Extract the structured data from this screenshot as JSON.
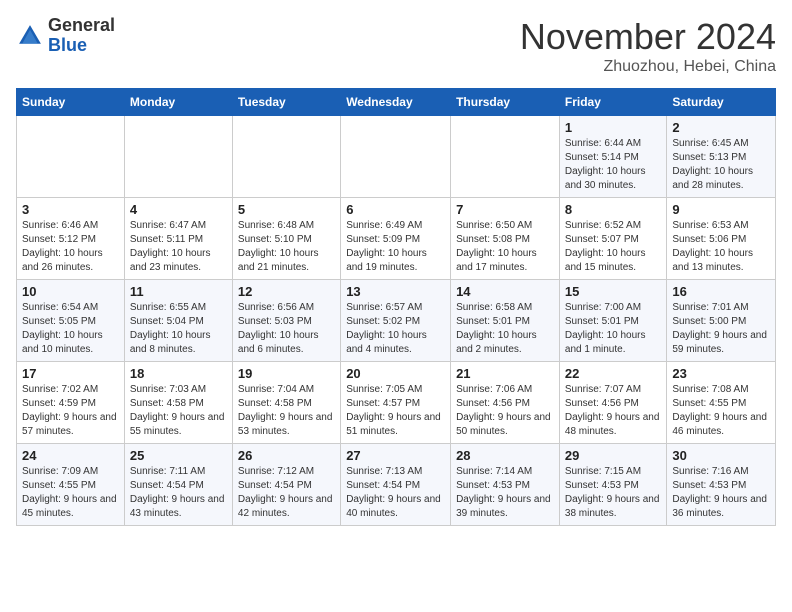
{
  "header": {
    "logo_general": "General",
    "logo_blue": "Blue",
    "month": "November 2024",
    "location": "Zhuozhou, Hebei, China"
  },
  "weekdays": [
    "Sunday",
    "Monday",
    "Tuesday",
    "Wednesday",
    "Thursday",
    "Friday",
    "Saturday"
  ],
  "weeks": [
    [
      {
        "day": "",
        "info": ""
      },
      {
        "day": "",
        "info": ""
      },
      {
        "day": "",
        "info": ""
      },
      {
        "day": "",
        "info": ""
      },
      {
        "day": "",
        "info": ""
      },
      {
        "day": "1",
        "info": "Sunrise: 6:44 AM\nSunset: 5:14 PM\nDaylight: 10 hours and 30 minutes."
      },
      {
        "day": "2",
        "info": "Sunrise: 6:45 AM\nSunset: 5:13 PM\nDaylight: 10 hours and 28 minutes."
      }
    ],
    [
      {
        "day": "3",
        "info": "Sunrise: 6:46 AM\nSunset: 5:12 PM\nDaylight: 10 hours and 26 minutes."
      },
      {
        "day": "4",
        "info": "Sunrise: 6:47 AM\nSunset: 5:11 PM\nDaylight: 10 hours and 23 minutes."
      },
      {
        "day": "5",
        "info": "Sunrise: 6:48 AM\nSunset: 5:10 PM\nDaylight: 10 hours and 21 minutes."
      },
      {
        "day": "6",
        "info": "Sunrise: 6:49 AM\nSunset: 5:09 PM\nDaylight: 10 hours and 19 minutes."
      },
      {
        "day": "7",
        "info": "Sunrise: 6:50 AM\nSunset: 5:08 PM\nDaylight: 10 hours and 17 minutes."
      },
      {
        "day": "8",
        "info": "Sunrise: 6:52 AM\nSunset: 5:07 PM\nDaylight: 10 hours and 15 minutes."
      },
      {
        "day": "9",
        "info": "Sunrise: 6:53 AM\nSunset: 5:06 PM\nDaylight: 10 hours and 13 minutes."
      }
    ],
    [
      {
        "day": "10",
        "info": "Sunrise: 6:54 AM\nSunset: 5:05 PM\nDaylight: 10 hours and 10 minutes."
      },
      {
        "day": "11",
        "info": "Sunrise: 6:55 AM\nSunset: 5:04 PM\nDaylight: 10 hours and 8 minutes."
      },
      {
        "day": "12",
        "info": "Sunrise: 6:56 AM\nSunset: 5:03 PM\nDaylight: 10 hours and 6 minutes."
      },
      {
        "day": "13",
        "info": "Sunrise: 6:57 AM\nSunset: 5:02 PM\nDaylight: 10 hours and 4 minutes."
      },
      {
        "day": "14",
        "info": "Sunrise: 6:58 AM\nSunset: 5:01 PM\nDaylight: 10 hours and 2 minutes."
      },
      {
        "day": "15",
        "info": "Sunrise: 7:00 AM\nSunset: 5:01 PM\nDaylight: 10 hours and 1 minute."
      },
      {
        "day": "16",
        "info": "Sunrise: 7:01 AM\nSunset: 5:00 PM\nDaylight: 9 hours and 59 minutes."
      }
    ],
    [
      {
        "day": "17",
        "info": "Sunrise: 7:02 AM\nSunset: 4:59 PM\nDaylight: 9 hours and 57 minutes."
      },
      {
        "day": "18",
        "info": "Sunrise: 7:03 AM\nSunset: 4:58 PM\nDaylight: 9 hours and 55 minutes."
      },
      {
        "day": "19",
        "info": "Sunrise: 7:04 AM\nSunset: 4:58 PM\nDaylight: 9 hours and 53 minutes."
      },
      {
        "day": "20",
        "info": "Sunrise: 7:05 AM\nSunset: 4:57 PM\nDaylight: 9 hours and 51 minutes."
      },
      {
        "day": "21",
        "info": "Sunrise: 7:06 AM\nSunset: 4:56 PM\nDaylight: 9 hours and 50 minutes."
      },
      {
        "day": "22",
        "info": "Sunrise: 7:07 AM\nSunset: 4:56 PM\nDaylight: 9 hours and 48 minutes."
      },
      {
        "day": "23",
        "info": "Sunrise: 7:08 AM\nSunset: 4:55 PM\nDaylight: 9 hours and 46 minutes."
      }
    ],
    [
      {
        "day": "24",
        "info": "Sunrise: 7:09 AM\nSunset: 4:55 PM\nDaylight: 9 hours and 45 minutes."
      },
      {
        "day": "25",
        "info": "Sunrise: 7:11 AM\nSunset: 4:54 PM\nDaylight: 9 hours and 43 minutes."
      },
      {
        "day": "26",
        "info": "Sunrise: 7:12 AM\nSunset: 4:54 PM\nDaylight: 9 hours and 42 minutes."
      },
      {
        "day": "27",
        "info": "Sunrise: 7:13 AM\nSunset: 4:54 PM\nDaylight: 9 hours and 40 minutes."
      },
      {
        "day": "28",
        "info": "Sunrise: 7:14 AM\nSunset: 4:53 PM\nDaylight: 9 hours and 39 minutes."
      },
      {
        "day": "29",
        "info": "Sunrise: 7:15 AM\nSunset: 4:53 PM\nDaylight: 9 hours and 38 minutes."
      },
      {
        "day": "30",
        "info": "Sunrise: 7:16 AM\nSunset: 4:53 PM\nDaylight: 9 hours and 36 minutes."
      }
    ]
  ]
}
